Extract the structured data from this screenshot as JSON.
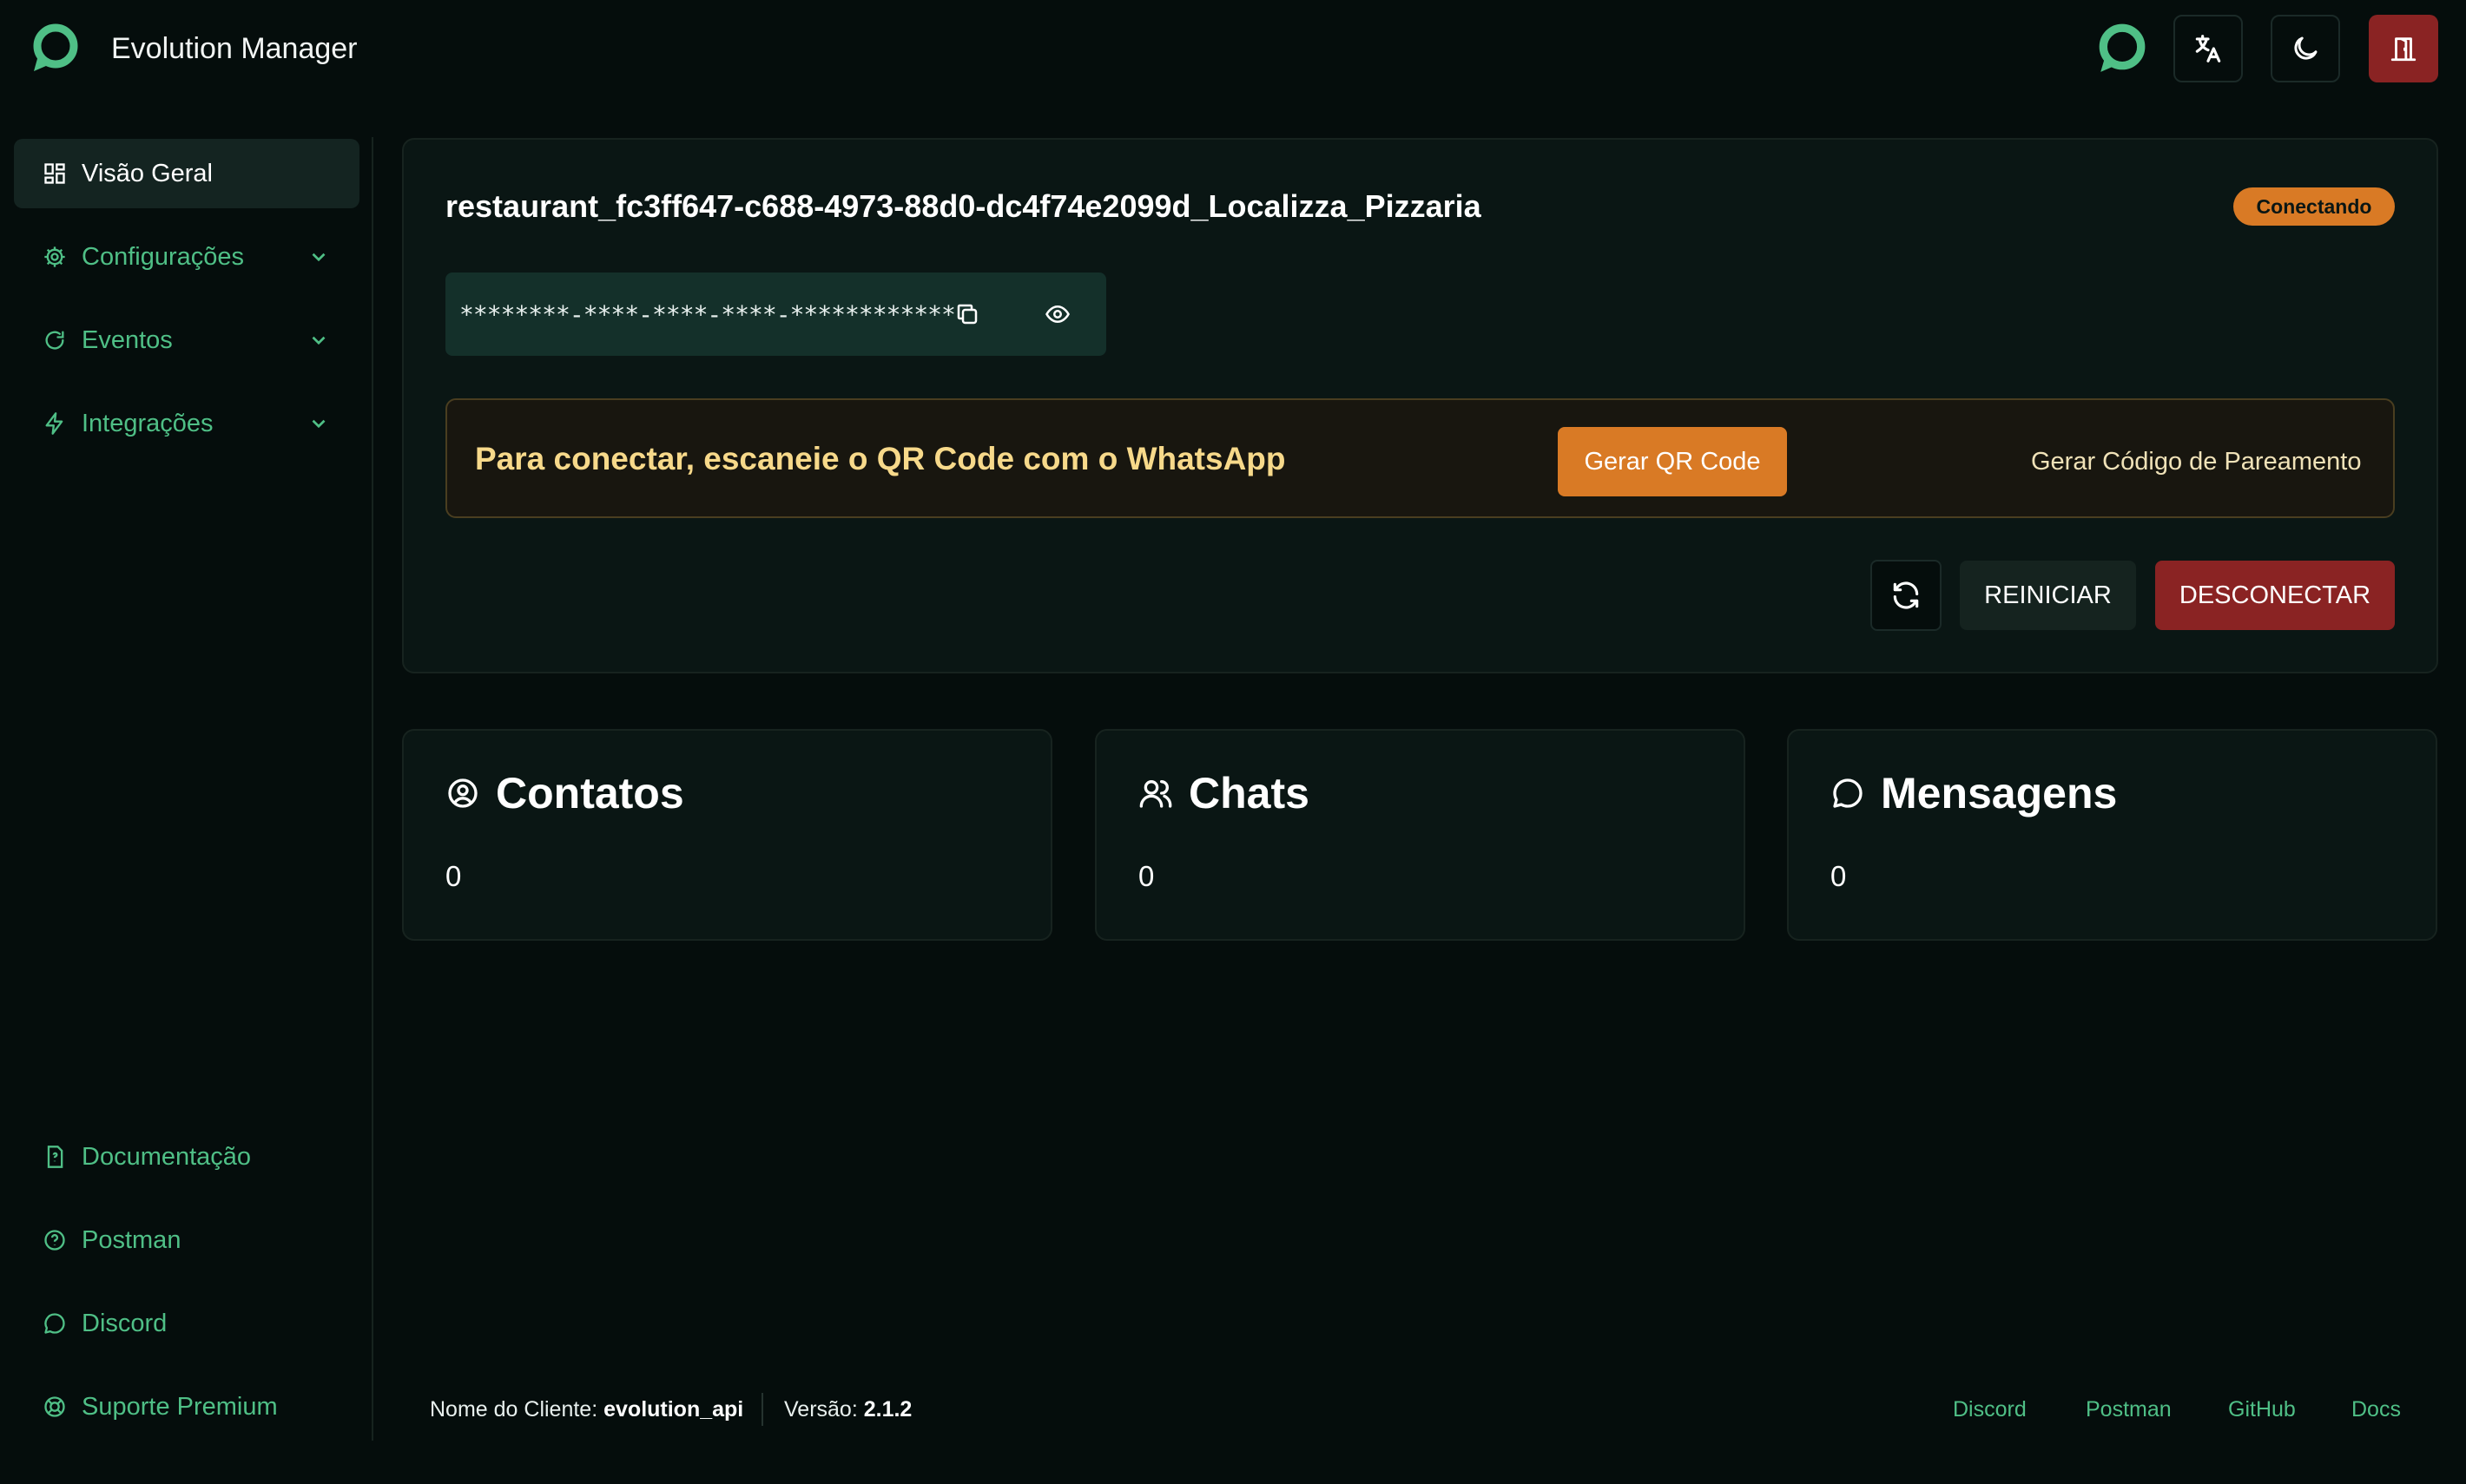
{
  "header": {
    "app_title": "Evolution Manager",
    "buttons": {
      "status_icon": "status-ring-icon",
      "language_icon": "translate-icon",
      "theme_icon": "moon-icon",
      "logout_icon": "door-icon"
    }
  },
  "sidebar": {
    "items": [
      {
        "label": "Visão Geral",
        "icon": "dashboard-icon",
        "active": true
      },
      {
        "label": "Configurações",
        "icon": "gear-icon",
        "expandable": true
      },
      {
        "label": "Eventos",
        "icon": "refresh-icon",
        "expandable": true
      },
      {
        "label": "Integrações",
        "icon": "bolt-icon",
        "expandable": true
      }
    ],
    "bottom_items": [
      {
        "label": "Documentação",
        "icon": "document-icon"
      },
      {
        "label": "Postman",
        "icon": "help-circle-icon"
      },
      {
        "label": "Discord",
        "icon": "chat-bubble-icon"
      },
      {
        "label": "Suporte Premium",
        "icon": "lifebuoy-icon"
      }
    ]
  },
  "instance": {
    "name": "restaurant_fc3ff647-c688-4973-88d0-dc4f74e2099d_Localizza_Pizzaria",
    "status": "Conectando",
    "token_masked": "********-****-****-****-************",
    "qr_prompt": "Para conectar, escaneie o QR Code com o WhatsApp",
    "generate_qr_label": "Gerar QR Code",
    "pairing_code_label": "Gerar Código de Pareamento",
    "restart_label": "REINICIAR",
    "disconnect_label": "DESCONECTAR"
  },
  "stats": [
    {
      "title": "Contatos",
      "value": "0",
      "icon": "user-circle-icon"
    },
    {
      "title": "Chats",
      "value": "0",
      "icon": "users-icon"
    },
    {
      "title": "Mensagens",
      "value": "0",
      "icon": "message-icon"
    }
  ],
  "footer": {
    "client_label": "Nome do Cliente:",
    "client_value": "evolution_api",
    "version_label": "Versão:",
    "version_value": "2.1.2",
    "links": [
      "Discord",
      "Postman",
      "GitHub",
      "Docs"
    ]
  },
  "colors": {
    "background": "#050d0c",
    "accent_green": "#4fbf86",
    "status_orange": "#d97a25",
    "danger_red": "#8a2323"
  }
}
